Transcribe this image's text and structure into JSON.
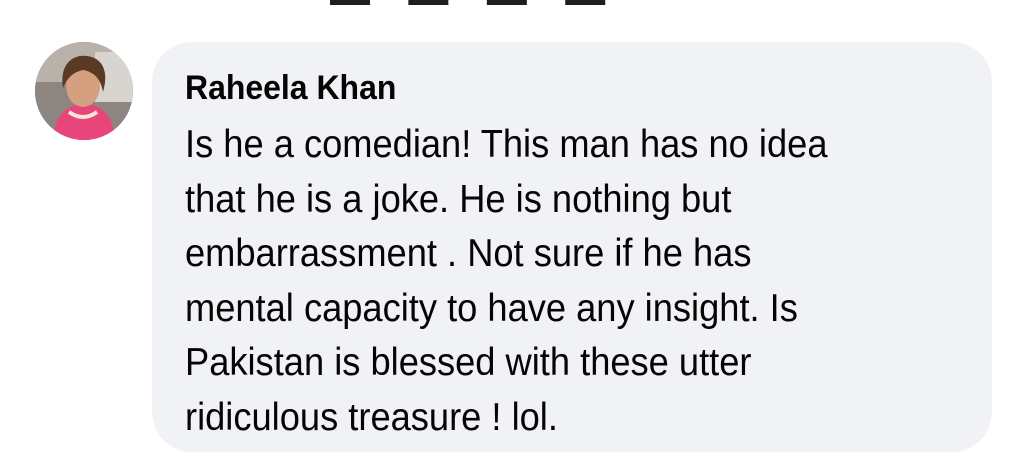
{
  "comment": {
    "author": "Raheela Khan",
    "lines": [
      "Is he a comedian! This man has no idea",
      "that he is a joke. He is nothing but",
      "embarrassment . Not sure if he has",
      "mental capacity to have any insight. Is",
      "Pakistan is blessed with these utter",
      "ridiculous treasure ! lol."
    ]
  },
  "colors": {
    "bubble_background": "#f0f2f5",
    "text": "#050505",
    "avatar_ring": "#e8457a"
  }
}
